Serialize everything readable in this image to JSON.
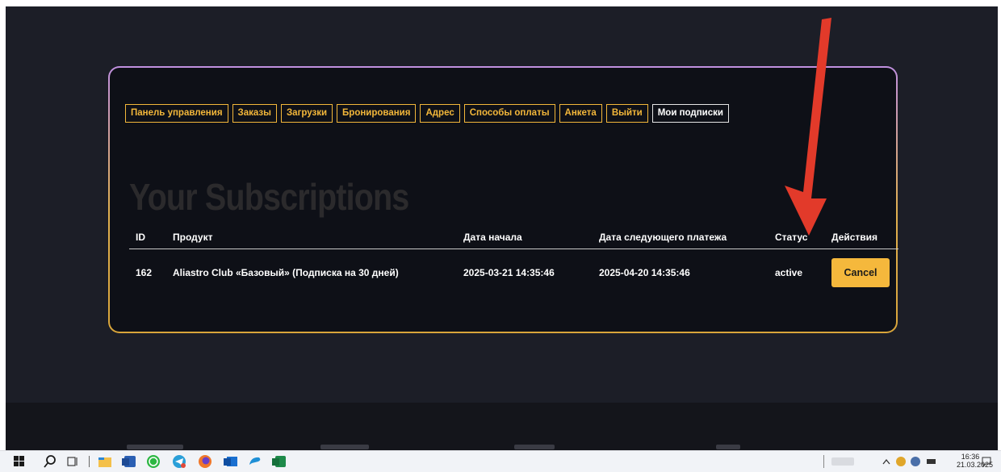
{
  "nav": {
    "items": [
      {
        "label": "Панель управления",
        "active": false
      },
      {
        "label": "Заказы",
        "active": false
      },
      {
        "label": "Загрузки",
        "active": false
      },
      {
        "label": "Бронирования",
        "active": false
      },
      {
        "label": "Адрес",
        "active": false
      },
      {
        "label": "Способы оплаты",
        "active": false
      },
      {
        "label": "Анкета",
        "active": false
      },
      {
        "label": "Выйти",
        "active": false
      },
      {
        "label": "Мои подписки",
        "active": true
      }
    ]
  },
  "heading": "Your Subscriptions",
  "table": {
    "headers": [
      "ID",
      "Продукт",
      "Дата начала",
      "Дата следующего платежа",
      "Статус",
      "Действия"
    ],
    "rows": [
      {
        "id": "162",
        "product": "Aliastro Club «Базовый» (Подписка на 30 дней)",
        "start": "2025-03-21 14:35:46",
        "next": "2025-04-20 14:35:46",
        "status": "active",
        "action": "Cancel"
      }
    ]
  },
  "taskbar": {
    "time": "16:36",
    "date": "21.03.2025",
    "icons": [
      "windows-start-icon",
      "search-icon",
      "task-view-icon",
      "file-explorer-icon",
      "word-icon",
      "whatsapp-icon",
      "telegram-icon",
      "firefox-icon",
      "outlook-icon",
      "edge-icon",
      "excel-icon"
    ]
  },
  "colors": {
    "accent": "#f3b73a",
    "page_bg": "#1c1e27",
    "card_bg": "#0e1017",
    "arrow": "#e23a2a"
  }
}
